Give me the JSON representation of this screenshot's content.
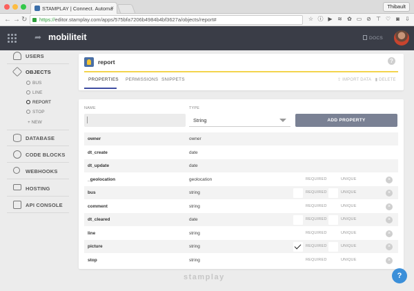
{
  "browser": {
    "tab_title": "STAMPLAY | Connect. Automa",
    "tab_close": "×",
    "user_name": "Thibault",
    "url_secure": "https://",
    "url_rest": "editor.stamplay.com/apps/575bfa7206b4984b4bf3627a/objects/report#"
  },
  "header": {
    "project_name": "mobiliteit",
    "docs_label": "DOCS"
  },
  "sidebar": {
    "items": [
      {
        "label": "USERS",
        "icon": "user-icon"
      },
      {
        "label": "OBJECTS",
        "icon": "cube-icon"
      },
      {
        "label": "DATABASE",
        "icon": "database-icon"
      },
      {
        "label": "CODE BLOCKS",
        "icon": "code-blocks-icon"
      },
      {
        "label": "WEBHOOKS",
        "icon": "webhooks-icon"
      },
      {
        "label": "HOSTING",
        "icon": "monitor-icon"
      },
      {
        "label": "API CONSOLE",
        "icon": "terminal-icon"
      }
    ],
    "objects": [
      {
        "label": "BUS"
      },
      {
        "label": "LINE"
      },
      {
        "label": "REPORT"
      },
      {
        "label": "STOP"
      },
      {
        "label": "+  NEW"
      }
    ]
  },
  "object": {
    "title": "report",
    "help": "?",
    "tabs": [
      "PROPERTIES",
      "PERMISSIONS",
      "SNIPPETS"
    ],
    "import_label": "IMPORT DATA",
    "delete_label": "DELETE"
  },
  "form": {
    "name_label": "NAME",
    "type_label": "TYPE",
    "name_value": "",
    "type_value": "String",
    "add_button": "ADD PROPERTY"
  },
  "labels": {
    "required": "REQUIRED",
    "unique": "UNIQUE",
    "delete": "×"
  },
  "properties": [
    {
      "name": "owner",
      "type": "owner",
      "system": true,
      "required": false
    },
    {
      "name": "dt_create",
      "type": "date",
      "system": true,
      "required": false
    },
    {
      "name": "dt_update",
      "type": "date",
      "system": true,
      "required": false
    },
    {
      "name": "_geolocation",
      "type": "geolocation",
      "system": false,
      "required": false
    },
    {
      "name": "bus",
      "type": "string",
      "system": false,
      "required": false
    },
    {
      "name": "comment",
      "type": "string",
      "system": false,
      "required": false
    },
    {
      "name": "dt_cleared",
      "type": "date",
      "system": false,
      "required": false
    },
    {
      "name": "line",
      "type": "string",
      "system": false,
      "required": false
    },
    {
      "name": "picture",
      "type": "string",
      "system": false,
      "required": true
    },
    {
      "name": "stop",
      "type": "string",
      "system": false,
      "required": false
    }
  ],
  "footer": {
    "logo": "stamplay",
    "chat": "?"
  }
}
